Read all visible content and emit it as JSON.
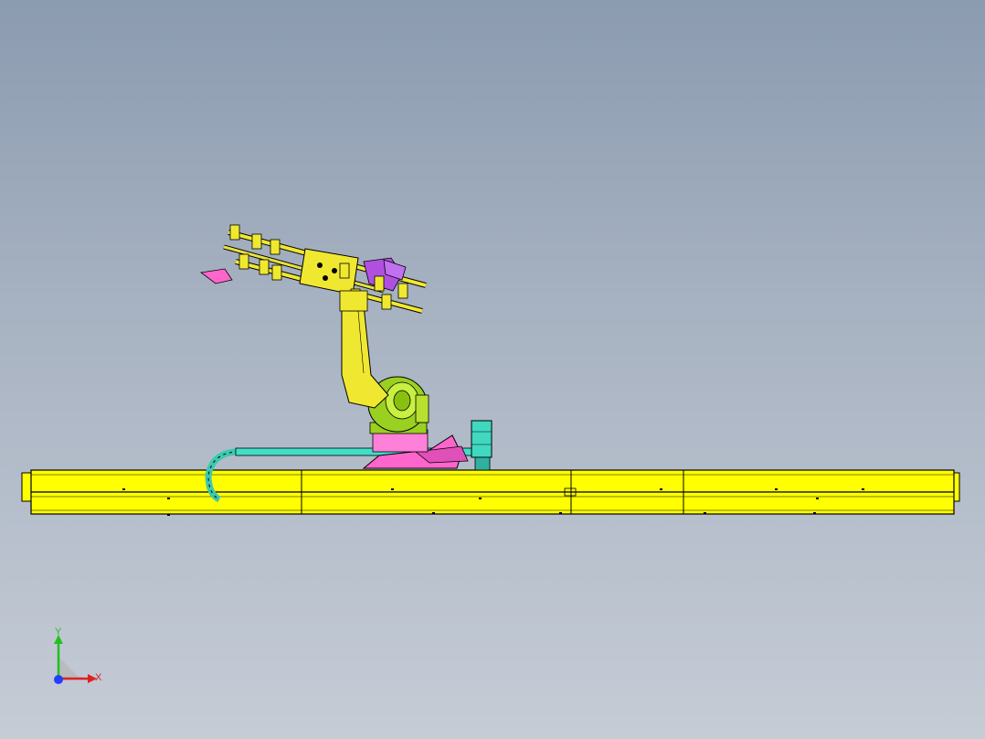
{
  "viewport": {
    "background_top": "#8b9bb0",
    "background_bottom": "#c6ccd6"
  },
  "model": {
    "rail_color": "#ffff00",
    "robot_color": "#f0e830",
    "base_color": "#ff66cc",
    "cable_color": "#40e0c8",
    "joint_color": "#9ad020",
    "gripper_accent": "#b050e0"
  },
  "triad": {
    "x_label": "X",
    "y_label": "Y",
    "x_color": "#e02020",
    "y_color": "#20c020",
    "origin_color": "#2040ff"
  }
}
